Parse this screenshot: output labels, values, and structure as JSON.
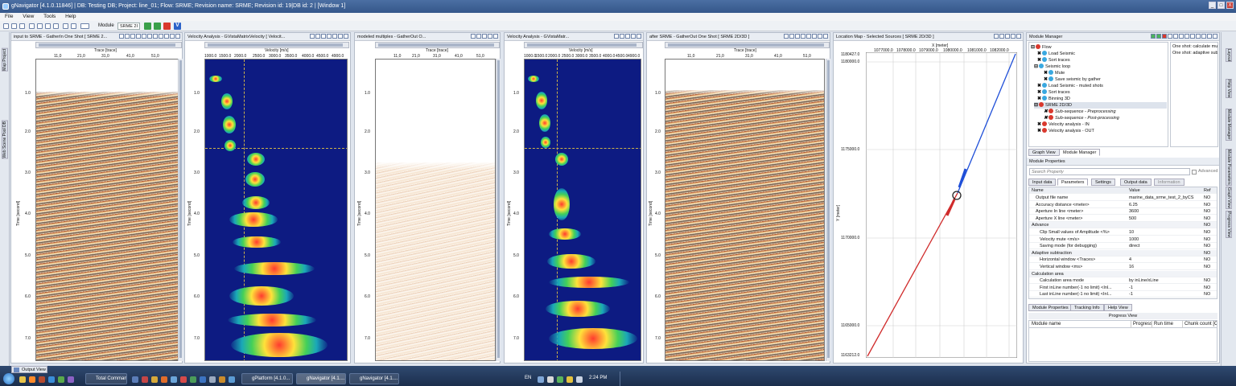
{
  "window": {
    "title": "gNavigator [4.1.0.11846] | DB: Testing DB; Project: line_01; Flow: SRME; Revision name: SRME; Revision id: 19|DB id: 2 | [Window 1]",
    "controls": [
      "_",
      "□",
      "X"
    ]
  },
  "menu": [
    "File",
    "View",
    "Tools",
    "Help"
  ],
  "toolbar": {
    "module_label": "Module",
    "module_value": "SRME 2I"
  },
  "left_sidebar": [
    "Map Project",
    "Web Scene Pool DB"
  ],
  "right_sidebar": [
    "Layout",
    "Help View",
    "Module Manager",
    "Module Parameters",
    "Graph View",
    "Progress View"
  ],
  "panels": [
    {
      "title": "input to SRME - GatherIn One Shot [ SRME 2...",
      "x_title": "Trace [trace]",
      "x_ticks": [
        "11,0",
        "21,0",
        "31,0",
        "41,0",
        "51,0"
      ],
      "y_title": "Time [second]",
      "y_ticks": [
        "1.0",
        "2.0",
        "3.0",
        "4.0",
        "5.0",
        "6.0",
        "7.0"
      ]
    },
    {
      "title": "Velocity Analysis - GVistaMatrixVelocity [ Velocit...",
      "x_title": "Velocity [m/s]",
      "x_ticks": [
        "1000.0",
        "1500.0",
        "2000.0",
        "2500.0",
        "3000.0",
        "3500.0",
        "4000.0",
        "4500.0",
        "4900.0"
      ],
      "y_title": "Time [second]",
      "y_ticks": [
        "1.0",
        "2.0",
        "3.0",
        "4.0",
        "5.0",
        "6.0",
        "7.0"
      ]
    },
    {
      "title": "modeled multiples - GatherOut O...",
      "x_title": "Trace [trace]",
      "x_ticks": [
        "11,0",
        "21,0",
        "31,0",
        "41,0",
        "51,0"
      ],
      "y_title": "Time [second]",
      "y_ticks": [
        "1.0",
        "2.0",
        "3.0",
        "4.0",
        "5.0",
        "6.0",
        "7.0"
      ]
    },
    {
      "title": "Velocity Analysis - GVistaMatr...",
      "x_title": "Velocity [m/s]",
      "x_ticks": [
        "1000.0",
        "1500.0",
        "2000.0",
        "2500.0",
        "3000.0",
        "3500.0",
        "4000.0",
        "4500.0",
        "4900.0"
      ],
      "y_title": "Time [second]",
      "y_ticks": [
        "1.0",
        "2.0",
        "3.0",
        "4.0",
        "5.0",
        "6.0",
        "7.0"
      ]
    },
    {
      "title": "after SRME - GatherOut One Shot [ SRME 2D/3D ]",
      "x_title": "Trace [trace]",
      "x_ticks": [
        "11,0",
        "21,0",
        "31,0",
        "41,0",
        "51,0"
      ],
      "y_title": "Time [second]",
      "y_ticks": [
        "1.0",
        "2.0",
        "3.0",
        "4.0",
        "5.0",
        "6.0",
        "7.0"
      ]
    }
  ],
  "location_map": {
    "title": "Location Map - Selected Sources [ SRME 2D/3D ]",
    "x_title": "X [meter]",
    "x_ticks": [
      "1077000.0",
      "1078000.0",
      "1079000.0",
      "1080000.0",
      "1081000.0",
      "1082000.0"
    ],
    "y_title": "Y [meter]",
    "y_ticks": [
      "1180427.0",
      "1180000.0",
      "1175000.0",
      "1170000.0",
      "1165000.0",
      "1163212.0"
    ]
  },
  "module_manager": {
    "title": "Module Manager",
    "tree": [
      {
        "label": "Flow",
        "level": 0,
        "italic": false
      },
      {
        "label": "Load Seismic",
        "level": 1,
        "italic": false
      },
      {
        "label": "Sort traces",
        "level": 1,
        "italic": false
      },
      {
        "label": "Seismic loop",
        "level": 1,
        "italic": false
      },
      {
        "label": "Mute",
        "level": 2,
        "italic": false
      },
      {
        "label": "Save seismic by gather",
        "level": 2,
        "italic": false
      },
      {
        "label": "Load Seismic - muted shots",
        "level": 1,
        "italic": false
      },
      {
        "label": "Sort traces",
        "level": 1,
        "italic": false
      },
      {
        "label": "Binning 3D",
        "level": 1,
        "italic": false
      },
      {
        "label": "SRME 2D/3D",
        "level": 1,
        "italic": false
      },
      {
        "label": "Sub-sequence - Preprocessing",
        "level": 2,
        "italic": true
      },
      {
        "label": "Sub-sequence - Post-processing",
        "level": 2,
        "italic": true
      },
      {
        "label": "Velocity analysis - IN",
        "level": 1,
        "italic": false
      },
      {
        "label": "Velocity analysis - OUT",
        "level": 1,
        "italic": false
      }
    ],
    "help_text": [
      "One shot: calculate mul",
      "One shot: adaptive subt"
    ],
    "tabs": [
      "Graph View",
      "Module Manager"
    ]
  },
  "module_properties": {
    "title": "Module Properties",
    "search_placeholder": "Search Property",
    "advanced_label": "Advanced",
    "tabs": [
      "Input data",
      "Parameters",
      "Settings",
      "Output data",
      "Information"
    ],
    "columns": [
      "Name",
      "Value",
      "Ref"
    ],
    "rows": [
      {
        "name": "Output file name",
        "value": "marine_data_srme_test_2_byCS",
        "ref": "NO",
        "indent": 1
      },
      {
        "name": "Accuracy distance <meter>",
        "value": "6.25",
        "ref": "NO",
        "indent": 1
      },
      {
        "name": "Aperture In line <meter>",
        "value": "3600",
        "ref": "NO",
        "indent": 1
      },
      {
        "name": "Aperture X line <meter>",
        "value": "500",
        "ref": "NO",
        "indent": 1
      },
      {
        "name": "Advance",
        "value": "",
        "ref": "NO",
        "indent": 0
      },
      {
        "name": "Clip Small values of Amplitude <%>",
        "value": "10",
        "ref": "NO",
        "indent": 2
      },
      {
        "name": "Velocity mute <m/s>",
        "value": "1000",
        "ref": "NO",
        "indent": 2
      },
      {
        "name": "Saving mode (for debugging)",
        "value": "direct",
        "ref": "NO",
        "indent": 2
      },
      {
        "name": "Adaptive subtraction",
        "value": "",
        "ref": "NO",
        "indent": 0
      },
      {
        "name": "Horizontal window <Traces>",
        "value": "4",
        "ref": "NO",
        "indent": 2
      },
      {
        "name": "Vertical window <ms>",
        "value": "16",
        "ref": "NO",
        "indent": 2
      },
      {
        "name": "Calculation area",
        "value": "",
        "ref": "",
        "indent": 0
      },
      {
        "name": "Calculation area mode",
        "value": "by inLine/xLine",
        "ref": "NO",
        "indent": 2
      },
      {
        "name": "First inLine number(-1 no limit) <Inl...",
        "value": "-1",
        "ref": "NO",
        "indent": 2
      },
      {
        "name": "Last inLine number(-1 no limit) <Inl...",
        "value": "-1",
        "ref": "NO",
        "indent": 2
      }
    ],
    "bottom_tabs": [
      "Module Properties",
      "Tracking Info",
      "Help View"
    ]
  },
  "progress_view": {
    "title": "Progress View",
    "columns": [
      "Module name",
      "Progress",
      "Run time",
      "Chunk count [Complete"
    ]
  },
  "output_view_label": "Output View",
  "taskbar": {
    "tasks": [
      "Total Command...",
      "gPlatform [4.1.0...",
      "gNavigator [4.1....",
      "gNavigator [4.1...."
    ],
    "lang": "EN",
    "time": "2:24 PM"
  },
  "colors": {
    "title_bar": "#3d6196",
    "velocity_bg": "#0d1b82",
    "map_line_red": "#d02b2b",
    "map_line_blue": "#1f4fd8"
  }
}
